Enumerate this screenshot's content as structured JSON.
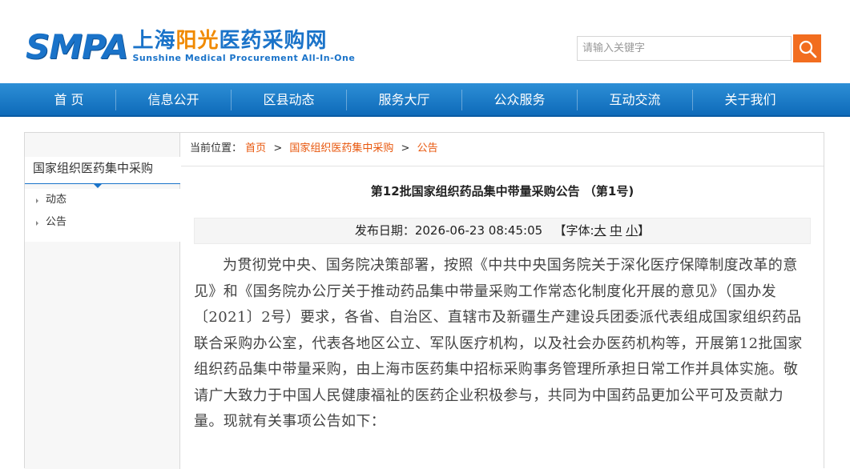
{
  "header": {
    "logo_smpa": "SMPA",
    "logo_cn_part1": "上海",
    "logo_cn_part2": "阳光",
    "logo_cn_part3": "医药采购网",
    "logo_en": "Sunshine Medical Procurement All-In-One",
    "search_placeholder": "请输入关键字"
  },
  "nav": {
    "items": [
      "首 页",
      "信息公开",
      "区县动态",
      "服务大厅",
      "公众服务",
      "互动交流",
      "关于我们"
    ]
  },
  "sidebar": {
    "title": "国家组织医药集中采购",
    "items": [
      "动态",
      "公告"
    ]
  },
  "breadcrumb": {
    "prefix": "当前位置：",
    "home": "首页",
    "section": "国家组织医药集中采购",
    "current": "公告",
    "separator": ">"
  },
  "article": {
    "title": "第12批国家组织药品集中带量采购公告 （第1号)",
    "date_label": "发布日期：",
    "date_value": "2026-06-23 08:45:05",
    "font_label_open": "【字体:",
    "font_large": "大",
    "font_medium": "中",
    "font_small": "小",
    "font_label_close": "】",
    "body": "为贯彻党中央、国务院决策部署，按照《中共中央国务院关于深化医疗保障制度改革的意见》和《国务院办公厅关于推动药品集中带量采购工作常态化制度化开展的意见》（国办发〔2021〕2号）要求，各省、自治区、直辖市及新疆生产建设兵团委派代表组成国家组织药品联合采购办公室，代表各地区公立、军队医疗机构，以及社会办医药机构等，开展第12批国家组织药品集中带量采购，由上海市医药集中招标采购事务管理所承担日常工作并具体实施。敬请广大致力于中国人民健康福祉的医药企业积极参与，共同为中国药品更加公平可及贡献力量。现就有关事项公告如下："
  },
  "colors": {
    "brand_blue": "#1a73c9",
    "accent_orange": "#f26d1f",
    "link_orange": "#e8570d"
  }
}
